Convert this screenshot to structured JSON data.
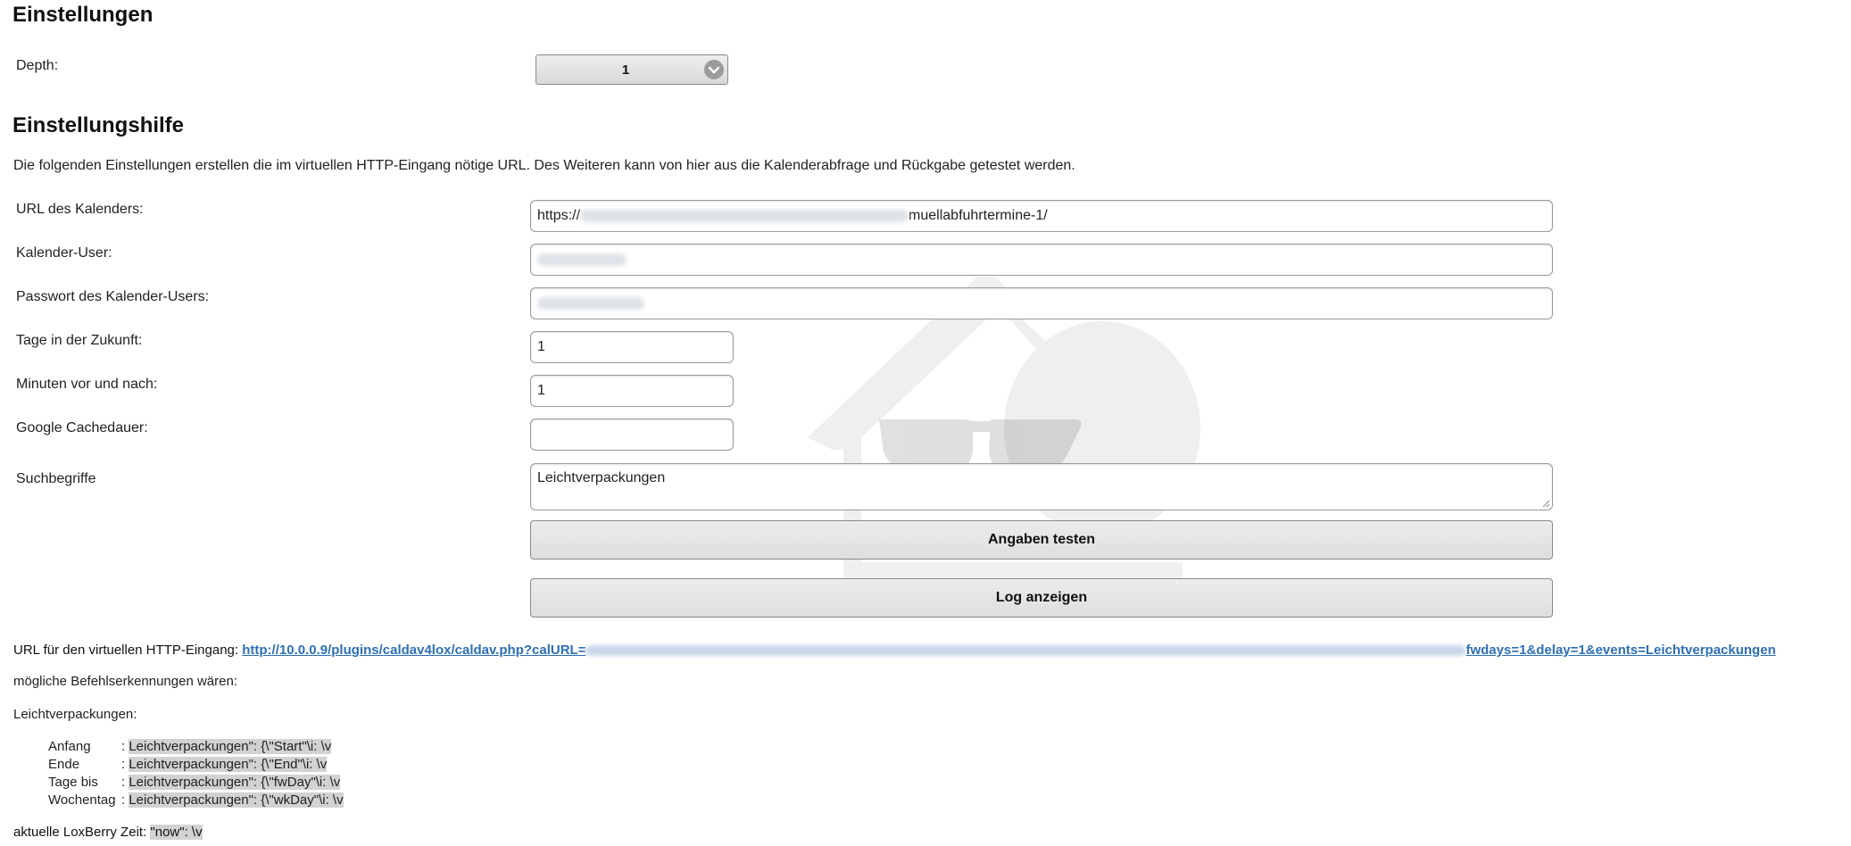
{
  "headings": {
    "settings": "Einstellungen",
    "help": "Einstellungshilfe"
  },
  "depth": {
    "label": "Depth:",
    "value": "1"
  },
  "intro": "Die folgenden Einstellungen erstellen die im virtuellen HTTP-Eingang nötige URL. Des Weiteren kann von hier aus die Kalenderabfrage und Rückgabe getestet werden.",
  "fields": {
    "url": {
      "label": "URL des Kalenders:",
      "prefix": "https://",
      "suffix": "muellabfuhrtermine-1/"
    },
    "user": {
      "label": "Kalender-User:"
    },
    "password": {
      "label": "Passwort des Kalender-Users:"
    },
    "days": {
      "label": "Tage in der Zukunft:",
      "value": "1"
    },
    "minutes": {
      "label": "Minuten vor und nach:",
      "value": "1"
    },
    "cache": {
      "label": "Google Cachedauer:",
      "value": ""
    },
    "search": {
      "label": "Suchbegriffe",
      "value": "Leichtverpackungen"
    }
  },
  "buttons": {
    "test": "Angaben testen",
    "log": "Log anzeigen"
  },
  "http_input": {
    "label": "URL für den virtuellen HTTP-Eingang:",
    "link_start": "http://10.0.0.9/plugins/caldav4lox/caldav.php?calURL=",
    "link_end": "fwdays=1&delay=1&events=Leichtverpackungen"
  },
  "recognitions": {
    "intro": "mögliche Befehlserkennungen wären:",
    "group": "Leichtverpackungen:",
    "rows": [
      {
        "key": "Anfang",
        "sep": ": ",
        "value": "Leichtverpackungen\": {\\\"Start\"\\i: \\v"
      },
      {
        "key": "Ende",
        "sep": ": ",
        "value": "Leichtverpackungen\": {\\\"End\"\\i: \\v"
      },
      {
        "key": "Tage bis",
        "sep": ": ",
        "value": "Leichtverpackungen\": {\\\"fwDay\"\\i: \\v"
      },
      {
        "key": "Wochentag",
        "sep": ": ",
        "value": "Leichtverpackungen\": {\\\"wkDay\"\\i: \\v"
      }
    ]
  },
  "loxberry_time": {
    "label": "aktuelle LoxBerry Zeit:",
    "value": "\"now\": \\v"
  }
}
